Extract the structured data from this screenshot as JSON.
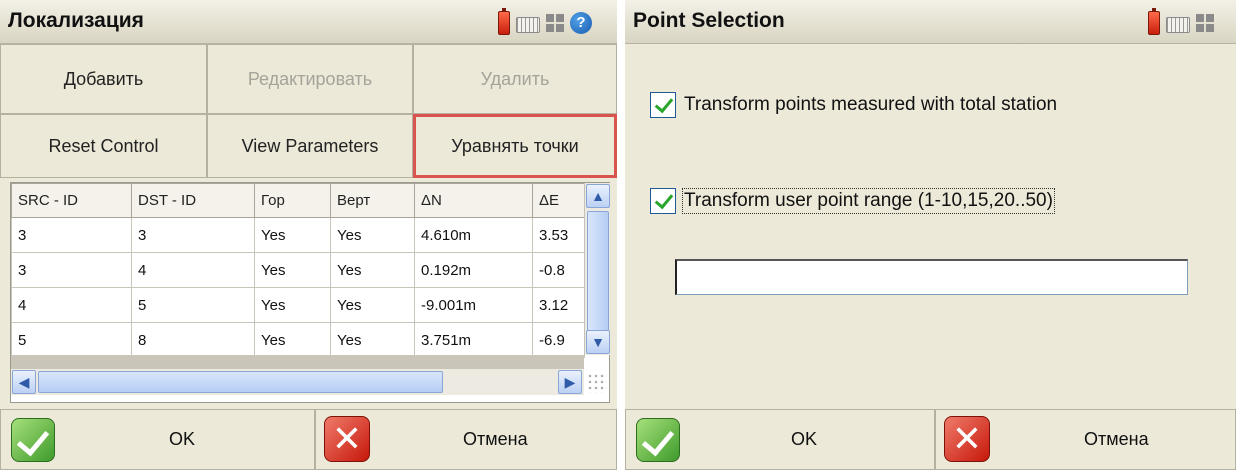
{
  "left": {
    "title": "Локализация",
    "buttons": {
      "add": "Добавить",
      "edit": "Редактировать",
      "delete": "Удалить",
      "reset_control": "Reset Control",
      "view_parameters": "View Parameters",
      "adjust_points": "Уравнять точки"
    },
    "table": {
      "headers": [
        "SRC - ID",
        "DST - ID",
        "Гор",
        "Верт",
        "ΔN",
        "ΔE"
      ],
      "rows": [
        [
          "3",
          "3",
          "Yes",
          "Yes",
          "4.610m",
          "3.53"
        ],
        [
          "3",
          "4",
          "Yes",
          "Yes",
          "0.192m",
          "-0.8"
        ],
        [
          "4",
          "5",
          "Yes",
          "Yes",
          "-9.001m",
          "3.12"
        ],
        [
          "5",
          "8",
          "Yes",
          "Yes",
          "3.751m",
          "-6.9"
        ]
      ]
    },
    "ok": "OK",
    "cancel": "Отмена"
  },
  "right": {
    "title": "Point Selection",
    "option1": "Transform points measured with total station",
    "option2": "Transform user point range (1-10,15,20..50)",
    "range_value": "",
    "ok": "OK",
    "cancel": "Отмена"
  },
  "colors": {
    "highlight": "#d9534f",
    "accent_blue": "#1a5cb0",
    "ok_green": "#3f9b2c",
    "cancel_red": "#c6180a"
  },
  "icons": [
    "battery-icon",
    "keyboard-icon",
    "grid-icon",
    "help-icon",
    "ok-check-icon",
    "cancel-x-icon"
  ]
}
